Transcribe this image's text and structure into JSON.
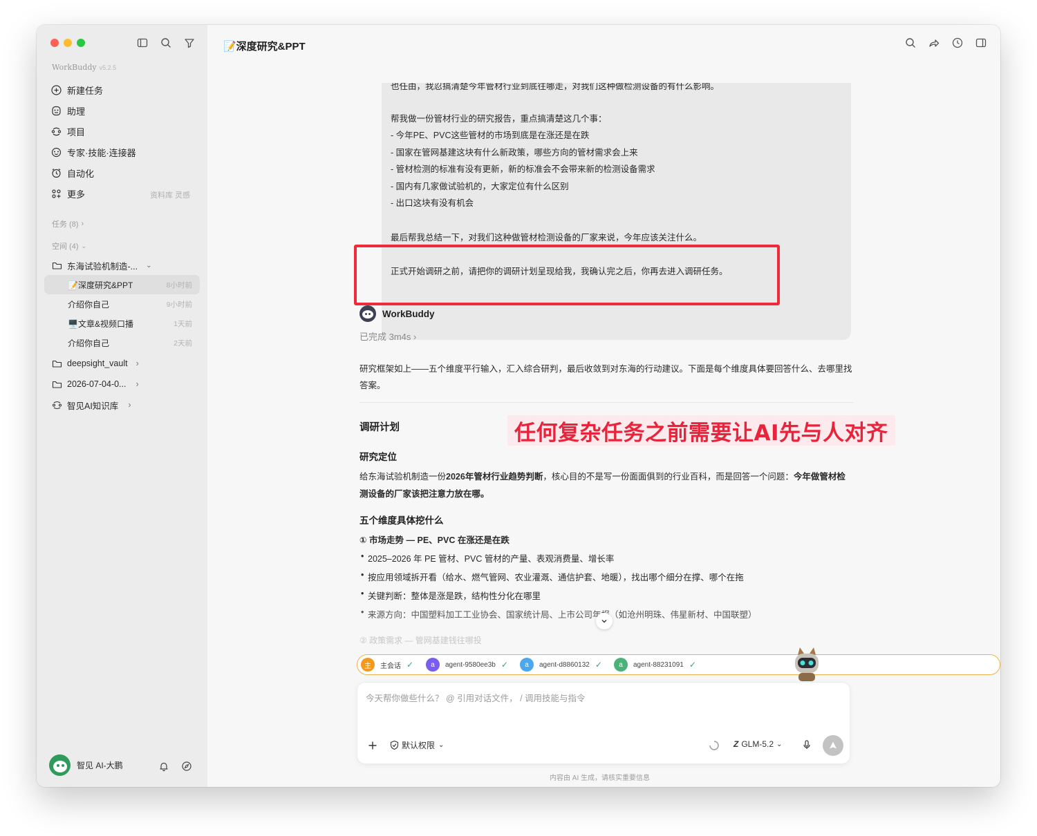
{
  "app": {
    "name": "WorkBuddy",
    "version": "v5.2.5"
  },
  "sidebar": {
    "nav": [
      {
        "label": "新建任务",
        "icon": "plus-circle-icon"
      },
      {
        "label": "助理",
        "icon": "assistant-icon"
      },
      {
        "label": "项目",
        "icon": "project-icon"
      },
      {
        "label": "专家·技能·连接器",
        "icon": "expert-icon"
      },
      {
        "label": "自动化",
        "icon": "automation-icon"
      },
      {
        "label": "更多",
        "icon": "grid-icon"
      }
    ],
    "more_hint": "资料库 灵感",
    "tasks_label": "任务 (8)",
    "spaces_label": "空间 (4)",
    "space_folder": "东海试验机制造-...",
    "space_items": [
      {
        "label": "📝深度研究&PPT",
        "time": "8小时前"
      },
      {
        "label": "介绍你自己",
        "time": "9小时前"
      },
      {
        "label": "🖥️文章&视频口播",
        "time": "1天前"
      },
      {
        "label": "介绍你自己",
        "time": "2天前"
      }
    ],
    "folders": [
      "deepsight_vault",
      "2026-07-04-0..."
    ],
    "knowledge": "智见AI知识库",
    "user_name": "智见 AI-大鹏"
  },
  "main": {
    "title": "📝深度研究&PPT",
    "user_message": {
      "cut_line": "也任由，我忍搞清楚今年管材行业到底往哪走，对我们这种做检测设备的有什么影响。",
      "intro": "帮我做一份管材行业的研究报告，重点搞清楚这几个事：",
      "points": [
        "- 今年PE、PVC这些管材的市场到底是在涨还是在跌",
        "- 国家在管网基建这块有什么新政策，哪些方向的管材需求会上来",
        "- 管材检测的标准有没有更新，新的标准会不会带来新的检测设备需求",
        "- 国内有几家做试验机的，大家定位有什么区别",
        "- 出口这块有没有机会"
      ],
      "summary": "最后帮我总结一下，对我们这种做管材检测设备的厂家来说，今年应该关注什么。",
      "highlight": "正式开始调研之前，请把你的调研计划呈现给我，我确认完之后，你再去进入调研任务。"
    },
    "assistant": {
      "name": "WorkBuddy",
      "status": "已完成 3m4s",
      "intro_line1": "研究框架如上——五个维度平行输入，汇入综合研判，最后收敛到对东海的行动建议。下面是每个维度具体要回答什么、去哪里找",
      "intro_line2": "答案。",
      "plan_heading": "调研计划",
      "position_heading": "研究定位",
      "position_line1_a": "给东海试验机制造一份",
      "position_line1_b": "2026年管材行业趋势判断",
      "position_line1_c": "，核心目的不是写一份面面俱到的行业百科，而是回答一个问题：",
      "position_line1_d": "今年做管材检",
      "position_line2": "测设备的厂家该把注意力放在哪。",
      "dims_heading": "五个维度具体挖什么",
      "dim1_title": "① 市场走势 — PE、PVC 在涨还是在跌",
      "dim1_bullets": [
        "2025–2026 年 PE 管材、PVC 管材的产量、表观消费量、增长率",
        "按应用领域拆开看（给水、燃气管网、农业灌溉、通信护套、地暖），找出哪个细分在撑、哪个在拖",
        "关键判断：整体是涨是跌，结构性分化在哪里",
        "来源方向：中国塑料加工工业协会、国家统计局、上市公司年报（如沧州明珠、伟星新材、中国联塑）"
      ],
      "dim2_faded": "② 政策需求 — 管网基建钱往哪投"
    },
    "annotation": "任何复杂任务之前需要让AI先与人对齐",
    "agents": [
      {
        "badge": "主",
        "label": "主会话",
        "color": "#f29a1d"
      },
      {
        "badge": "a",
        "label": "agent-9580ee3b",
        "color": "#7b5cf0"
      },
      {
        "badge": "a",
        "label": "agent-d8860132",
        "color": "#4aa7f0"
      },
      {
        "badge": "a",
        "label": "agent-88231091",
        "color": "#4bb37a"
      }
    ],
    "input": {
      "placeholder": "今天帮你做些什么？ @ 引用对话文件， / 调用技能与指令",
      "permission": "默认权限",
      "model": "GLM-5.2"
    },
    "footnote": "内容由 AI 生成，请核实重要信息"
  },
  "colors": {
    "accent_red": "#ef2b3a",
    "annotation_red": "#e8243c",
    "check_green": "#3aa76d"
  }
}
